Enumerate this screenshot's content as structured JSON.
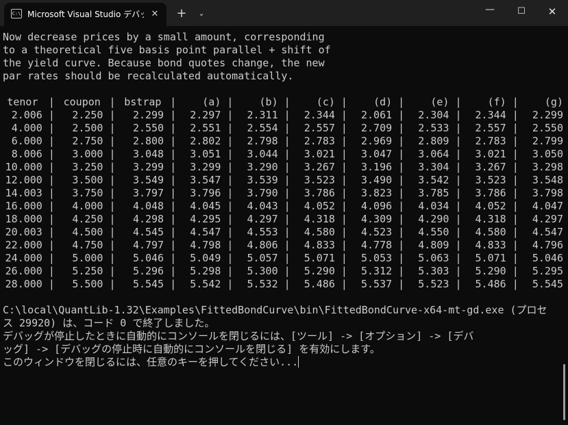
{
  "window": {
    "tab_icon_text": "C:\\",
    "tab_title": "Microsoft Visual Studio デバッグ",
    "tab_close_glyph": "✕",
    "new_tab_glyph": "+",
    "dropdown_glyph": "⌄",
    "minimize_glyph": "—",
    "maximize_glyph": "☐",
    "close_glyph": "✕"
  },
  "console": {
    "intro_lines": [
      "Now decrease prices by a small amount, corresponding",
      "to a theoretical five basis point parallel + shift of",
      "the yield curve. Because bond quotes change, the new",
      "par rates should be recalculated automatically."
    ],
    "table": {
      "headers": [
        "tenor",
        "coupon",
        "bstrap",
        "(a)",
        "(b)",
        "(c)",
        "(d)",
        "(e)",
        "(f)",
        "(g)"
      ],
      "rows": [
        [
          "2.006",
          "2.250",
          "2.299",
          "2.297",
          "2.311",
          "2.344",
          "2.061",
          "2.304",
          "2.344",
          "2.299"
        ],
        [
          "4.000",
          "2.500",
          "2.550",
          "2.551",
          "2.554",
          "2.557",
          "2.709",
          "2.533",
          "2.557",
          "2.550"
        ],
        [
          "6.000",
          "2.750",
          "2.800",
          "2.802",
          "2.798",
          "2.783",
          "2.969",
          "2.809",
          "2.783",
          "2.799"
        ],
        [
          "8.006",
          "3.000",
          "3.048",
          "3.051",
          "3.044",
          "3.021",
          "3.047",
          "3.064",
          "3.021",
          "3.050"
        ],
        [
          "10.000",
          "3.250",
          "3.299",
          "3.299",
          "3.290",
          "3.267",
          "3.196",
          "3.304",
          "3.267",
          "3.298"
        ],
        [
          "12.000",
          "3.500",
          "3.549",
          "3.547",
          "3.539",
          "3.523",
          "3.490",
          "3.542",
          "3.523",
          "3.548"
        ],
        [
          "14.003",
          "3.750",
          "3.797",
          "3.796",
          "3.790",
          "3.786",
          "3.823",
          "3.785",
          "3.786",
          "3.798"
        ],
        [
          "16.000",
          "4.000",
          "4.048",
          "4.045",
          "4.043",
          "4.052",
          "4.096",
          "4.034",
          "4.052",
          "4.047"
        ],
        [
          "18.000",
          "4.250",
          "4.298",
          "4.295",
          "4.297",
          "4.318",
          "4.309",
          "4.290",
          "4.318",
          "4.297"
        ],
        [
          "20.003",
          "4.500",
          "4.545",
          "4.547",
          "4.553",
          "4.580",
          "4.523",
          "4.550",
          "4.580",
          "4.547"
        ],
        [
          "22.000",
          "4.750",
          "4.797",
          "4.798",
          "4.806",
          "4.833",
          "4.778",
          "4.809",
          "4.833",
          "4.796"
        ],
        [
          "24.000",
          "5.000",
          "5.046",
          "5.049",
          "5.057",
          "5.071",
          "5.053",
          "5.063",
          "5.071",
          "5.046"
        ],
        [
          "26.000",
          "5.250",
          "5.296",
          "5.298",
          "5.300",
          "5.290",
          "5.312",
          "5.303",
          "5.290",
          "5.295"
        ],
        [
          "28.000",
          "5.500",
          "5.545",
          "5.542",
          "5.532",
          "5.486",
          "5.537",
          "5.523",
          "5.486",
          "5.545"
        ]
      ]
    },
    "exit_lines": [
      "C:\\local\\QuantLib-1.32\\Examples\\FittedBondCurve\\bin\\FittedBondCurve-x64-mt-gd.exe (プロセ",
      "ス 29920) は、コード 0 で終了しました。",
      "デバッグが停止したときに自動的にコンソールを閉じるには、[ツール] -> [オプション] -> [デバ",
      "ッグ] -> [デバッグの停止時に自動的にコンソールを閉じる] を有効にします。",
      "このウィンドウを閉じるには、任意のキーを押してください..."
    ]
  }
}
